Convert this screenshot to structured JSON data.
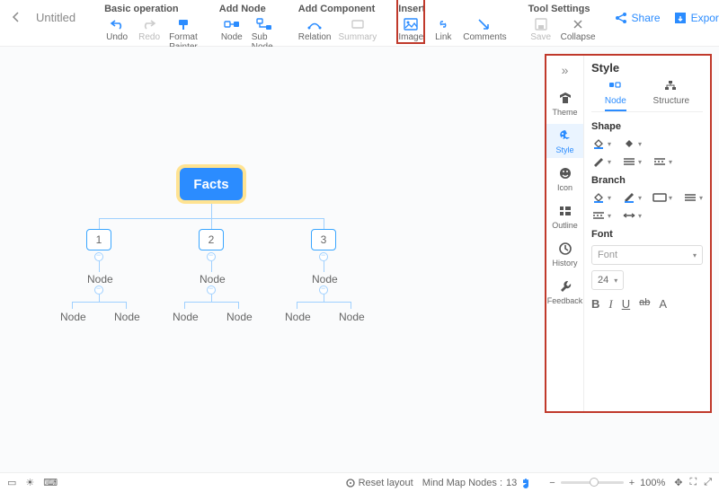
{
  "doc": {
    "title": "Untitled"
  },
  "toolbar": {
    "groups": {
      "basic": {
        "label": "Basic operation",
        "undo": "Undo",
        "redo": "Redo",
        "format_painter": "Format Painter"
      },
      "addNode": {
        "label": "Add Node",
        "node": "Node",
        "sub_node": "Sub Node"
      },
      "addComponent": {
        "label": "Add Component",
        "relation": "Relation",
        "summary": "Summary"
      },
      "insert": {
        "label": "Insert",
        "image": "Image",
        "link": "Link",
        "comments": "Comments"
      },
      "toolSettings": {
        "label": "Tool Settings",
        "save": "Save",
        "collapse": "Collapse"
      }
    },
    "share": "Share",
    "export": "Export"
  },
  "map": {
    "root": "Facts",
    "children": [
      "1",
      "2",
      "3"
    ],
    "node_label": "Node"
  },
  "sidebar": {
    "title": "Style",
    "rail": {
      "theme": "Theme",
      "style": "Style",
      "icon": "Icon",
      "outline": "Outline",
      "history": "History",
      "feedback": "Feedback"
    },
    "tabs": {
      "node": "Node",
      "structure": "Structure"
    },
    "sections": {
      "shape": "Shape",
      "branch": "Branch",
      "font": "Font"
    },
    "font_placeholder": "Font",
    "font_size": "24"
  },
  "bottombar": {
    "reset": "Reset layout",
    "nodeslabel": "Mind Map Nodes :",
    "nodecount": "13",
    "zoom": "100%"
  }
}
